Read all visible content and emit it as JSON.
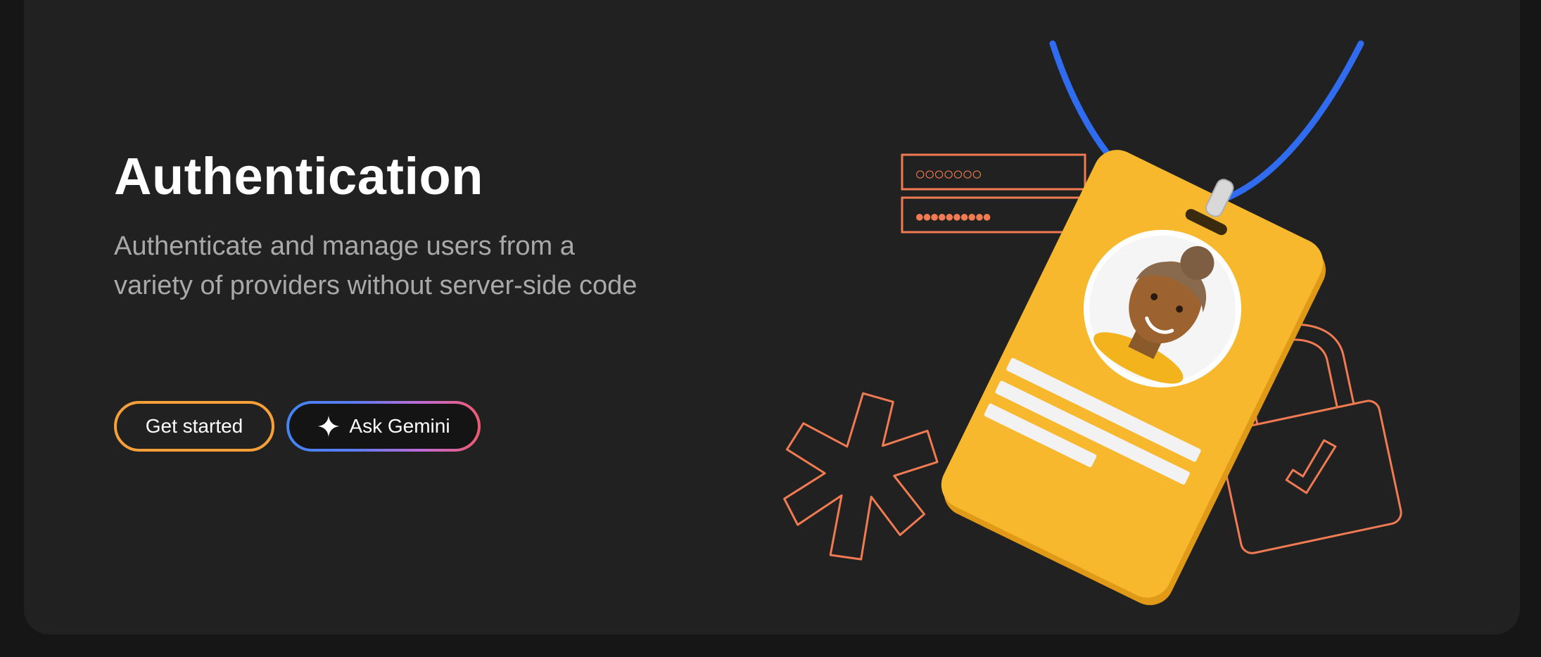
{
  "hero": {
    "title": "Authentication",
    "description": "Authenticate and manage users from a variety of providers without server-side code"
  },
  "buttons": {
    "get_started": "Get started",
    "ask_gemini": "Ask Gemini"
  },
  "illustration": {
    "username_mask": "○○○○○○○",
    "password_mask": "●●●●●●●●●●"
  },
  "colors": {
    "background": "#212121",
    "accent_orange": "#f6a03a",
    "outline_coral": "#f07b52",
    "badge_yellow": "#f7b82e",
    "lanyard_blue": "#2f6cf0"
  },
  "icons": {
    "gemini": "spark-icon",
    "lock": "lock-check-icon",
    "asterisk": "asterisk-icon",
    "badge": "id-badge-illustration"
  }
}
